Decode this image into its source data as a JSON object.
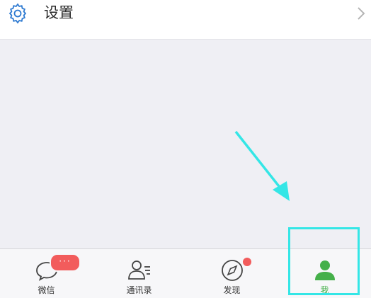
{
  "settings": {
    "title": "设置",
    "icon": "gear-icon"
  },
  "tabs": [
    {
      "label": "微信",
      "icon": "chat-bubble-icon",
      "badge": "···"
    },
    {
      "label": "通讯录",
      "icon": "contacts-icon"
    },
    {
      "label": "发现",
      "icon": "compass-icon"
    },
    {
      "label": "我",
      "icon": "person-icon",
      "active": true
    }
  ],
  "colors": {
    "active": "#45b04a",
    "badge": "#f25c5c",
    "annotation": "#34e6e6"
  }
}
